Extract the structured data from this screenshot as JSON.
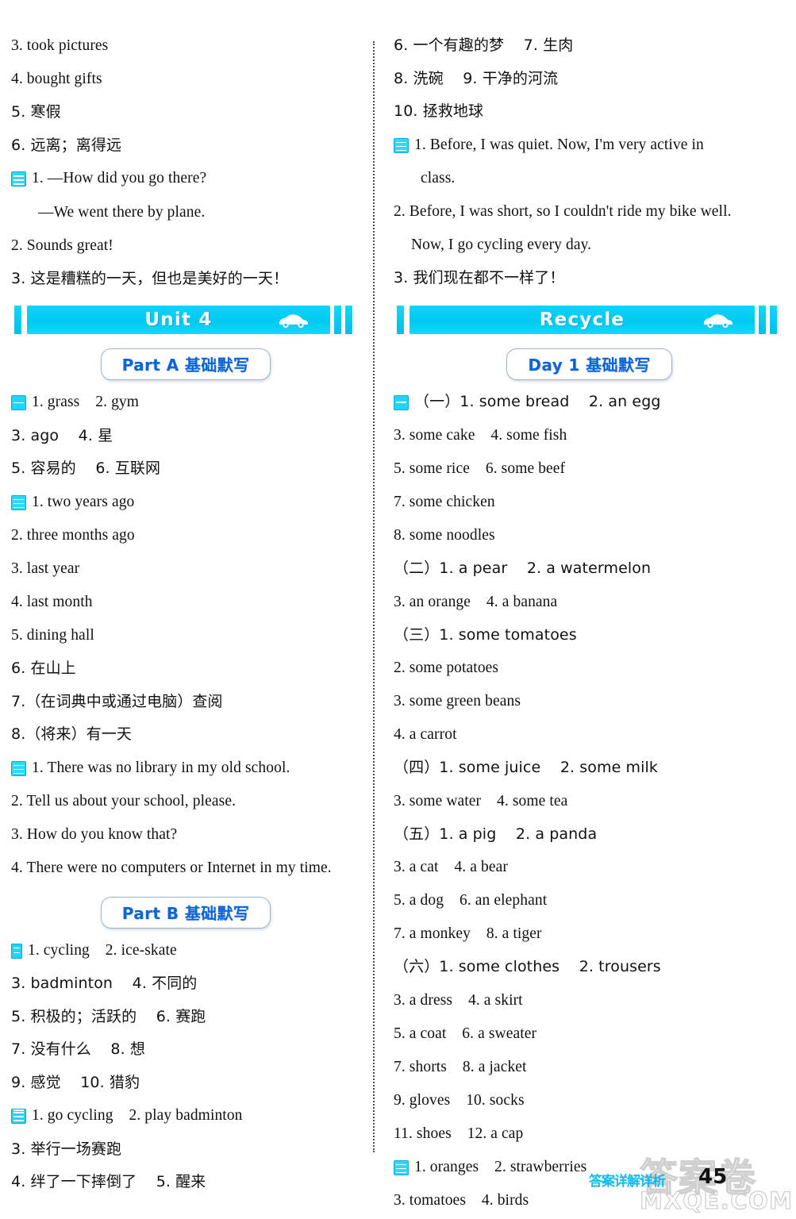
{
  "page": {
    "number": "45",
    "footer_label": "答案详解详析",
    "watermark_top": "答案卷",
    "watermark_bottom": "MXQE.COM"
  },
  "left_column": {
    "continued_lines": [
      {
        "text": "3. took pictures",
        "marker": null,
        "cn": false
      },
      {
        "text": "4. bought gifts",
        "marker": null,
        "cn": false
      },
      {
        "text": "5. 寒假",
        "marker": null,
        "cn": true
      },
      {
        "text": "6. 远离；离得远",
        "marker": null,
        "cn": true
      },
      {
        "text": "1. —How did you go there?",
        "marker": "m3",
        "cn": false
      },
      {
        "text": "—We went there by plane.",
        "marker": null,
        "cn": false,
        "indent": true
      },
      {
        "text": "2. Sounds great!",
        "marker": null,
        "cn": false
      },
      {
        "text": "3. 这是糟糕的一天，但也是美好的一天！",
        "marker": null,
        "cn": true
      }
    ],
    "unit_banner": {
      "title": "Unit 4",
      "icon": "car-icon"
    },
    "part_a": {
      "badge": "Part A 基础默写",
      "lines": [
        {
          "text": "1. grass    2. gym",
          "marker": "m1",
          "cn": false
        },
        {
          "text": "3. ago    4. 星",
          "marker": null,
          "cn": true
        },
        {
          "text": "5. 容易的    6. 互联网",
          "marker": null,
          "cn": true
        },
        {
          "text": "1. two years ago",
          "marker": "m3",
          "cn": false
        },
        {
          "text": "2. three months ago",
          "marker": null,
          "cn": false
        },
        {
          "text": "3. last year",
          "marker": null,
          "cn": false
        },
        {
          "text": "4. last month",
          "marker": null,
          "cn": false
        },
        {
          "text": "5. dining hall",
          "marker": null,
          "cn": false
        },
        {
          "text": "6. 在山上",
          "marker": null,
          "cn": true
        },
        {
          "text": "7.（在词典中或通过电脑）查阅",
          "marker": null,
          "cn": true
        },
        {
          "text": "8.（将来）有一天",
          "marker": null,
          "cn": true
        },
        {
          "text": "1. There was no library in my old school.",
          "marker": "m3",
          "cn": false
        },
        {
          "text": "2. Tell us about your school, please.",
          "marker": null,
          "cn": false
        },
        {
          "text": "3. How do you know that?",
          "marker": null,
          "cn": false
        },
        {
          "text": "4. There were no computers or Internet in my time.",
          "marker": null,
          "cn": false
        }
      ]
    },
    "part_b": {
      "badge": "Part B 基础默写",
      "lines": [
        {
          "text": "1. cycling    2. ice-skate",
          "marker": "mn",
          "cn": false
        },
        {
          "text": "3. badminton    4. 不同的",
          "marker": null,
          "cn": true
        },
        {
          "text": "5. 积极的；活跃的    6. 赛跑",
          "marker": null,
          "cn": true
        },
        {
          "text": "7. 没有什么    8. 想",
          "marker": null,
          "cn": true
        },
        {
          "text": "9. 感觉    10. 猎豹",
          "marker": null,
          "cn": true
        },
        {
          "text": "1. go cycling    2. play badminton",
          "marker": "mn2",
          "cn": false
        },
        {
          "text": "3. 举行一场赛跑",
          "marker": null,
          "cn": true
        },
        {
          "text": "4. 绊了一下摔倒了    5. 醒来",
          "marker": null,
          "cn": true
        }
      ]
    }
  },
  "right_column": {
    "continued_lines": [
      {
        "text": "6. 一个有趣的梦    7. 生肉",
        "marker": null,
        "cn": true
      },
      {
        "text": "8. 洗碗    9. 干净的河流",
        "marker": null,
        "cn": true
      },
      {
        "text": "10. 拯救地球",
        "marker": null,
        "cn": true
      },
      {
        "text": "1. Before, I was quiet. Now, I'm very active in",
        "marker": "m3",
        "cn": false
      },
      {
        "text": "class.",
        "marker": null,
        "cn": false,
        "indent": true
      },
      {
        "text": "2. Before, I was short, so I couldn't ride my bike well.",
        "marker": null,
        "cn": false
      },
      {
        "text": "Now, I go cycling every day.",
        "marker": null,
        "cn": false,
        "indent2": true
      },
      {
        "text": "3. 我们现在都不一样了！",
        "marker": null,
        "cn": true
      }
    ],
    "unit_banner": {
      "title": "Recycle",
      "icon": "car-icon"
    },
    "day_1": {
      "badge": "Day 1 基础默写",
      "lines": [
        {
          "text": "（一）1. some bread    2. an egg",
          "marker": "m1",
          "cn": true
        },
        {
          "text": "3. some cake    4. some fish",
          "marker": null,
          "cn": false
        },
        {
          "text": "5. some rice    6. some beef",
          "marker": null,
          "cn": false
        },
        {
          "text": "7. some chicken",
          "marker": null,
          "cn": false
        },
        {
          "text": "8. some noodles",
          "marker": null,
          "cn": false
        },
        {
          "text": "（二）1. a pear    2. a watermelon",
          "marker": null,
          "cn": true
        },
        {
          "text": "3. an orange    4. a banana",
          "marker": null,
          "cn": false
        },
        {
          "text": "（三）1. some tomatoes",
          "marker": null,
          "cn": true
        },
        {
          "text": "2. some potatoes",
          "marker": null,
          "cn": false
        },
        {
          "text": "3. some green beans",
          "marker": null,
          "cn": false
        },
        {
          "text": "4. a carrot",
          "marker": null,
          "cn": false
        },
        {
          "text": "（四）1. some juice    2. some milk",
          "marker": null,
          "cn": true
        },
        {
          "text": "3. some water    4. some tea",
          "marker": null,
          "cn": false
        },
        {
          "text": "（五）1. a pig    2. a panda",
          "marker": null,
          "cn": true
        },
        {
          "text": "3. a cat    4. a bear",
          "marker": null,
          "cn": false
        },
        {
          "text": "5. a dog    6. an elephant",
          "marker": null,
          "cn": false
        },
        {
          "text": "7. a monkey    8. a tiger",
          "marker": null,
          "cn": false
        },
        {
          "text": "（六）1. some clothes    2. trousers",
          "marker": null,
          "cn": true
        },
        {
          "text": "3. a dress    4. a skirt",
          "marker": null,
          "cn": false
        },
        {
          "text": "5. a coat    6. a sweater",
          "marker": null,
          "cn": false
        },
        {
          "text": "7. shorts    8. a jacket",
          "marker": null,
          "cn": false
        },
        {
          "text": "9. gloves    10. socks",
          "marker": null,
          "cn": false
        },
        {
          "text": "11. shoes    12. a cap",
          "marker": null,
          "cn": false
        },
        {
          "text": "1. oranges    2. strawberries",
          "marker": "m3",
          "cn": false
        },
        {
          "text": "3. tomatoes    4. birds",
          "marker": null,
          "cn": false
        }
      ]
    }
  },
  "colors": {
    "banner_cyan": "#00c8f0",
    "badge_blue": "#0a66d8",
    "marker_cyan": "#24d4f7",
    "text_black": "#111111"
  }
}
